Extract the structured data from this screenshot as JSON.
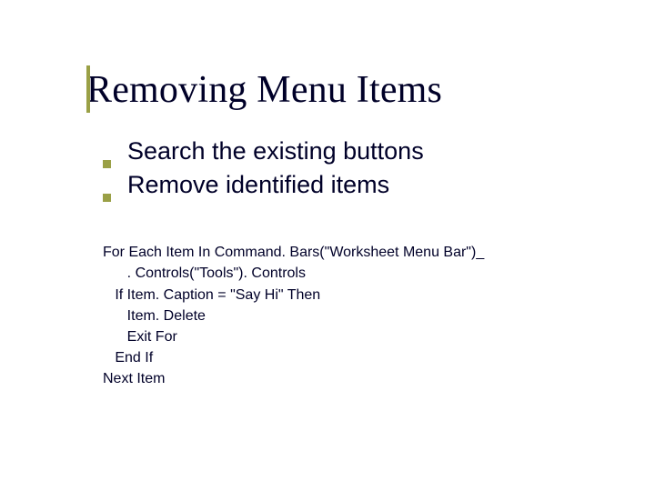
{
  "title": "Removing Menu Items",
  "bullets": [
    "Search the existing buttons",
    "Remove identified items"
  ],
  "code": {
    "l1": "For Each Item In Command. Bars(\"Worksheet Menu Bar\")_",
    "l2": "      . Controls(\"Tools\"). Controls",
    "l3": "   If Item. Caption = \"Say Hi\" Then",
    "l4": "      Item. Delete",
    "l5": "      Exit For",
    "l6": "   End If",
    "l7": "Next Item"
  }
}
